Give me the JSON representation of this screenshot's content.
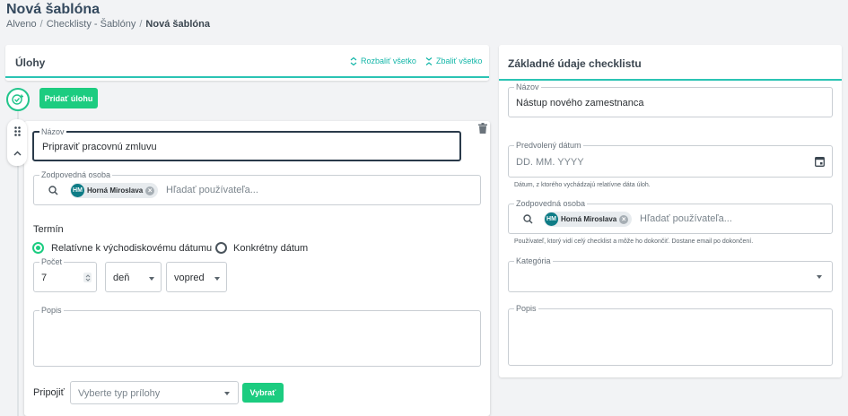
{
  "page": {
    "title": "Nová šablóna"
  },
  "breadcrumb": {
    "items": [
      "Alveno",
      "Checklisty - Šablóny",
      "Nová šablóna"
    ]
  },
  "tasks_panel": {
    "title": "Úlohy",
    "expand_all": "Rozbaliť všetko",
    "collapse_all": "Zbaliť všetko",
    "add_task": "Pridať úlohu"
  },
  "task": {
    "name_label": "Názov",
    "name_value": "Pripraviť pracovnú zmluvu",
    "responsible_label": "Zodpovedná osoba",
    "responsible_chip_initials": "HM",
    "responsible_chip_name": "Horná Miroslava",
    "responsible_placeholder": "Hľadať používateľa...",
    "deadline_label": "Termín",
    "radio_relative": "Relatívne k východiskovému dátumu",
    "radio_specific": "Konkrétny dátum",
    "count_label": "Počet",
    "count_value": "7",
    "unit_value": "deň",
    "direction_value": "vopred",
    "description_label": "Popis",
    "attach_label": "Pripojiť",
    "attach_placeholder": "Vyberte typ prílohy",
    "choose_button": "Vybrať"
  },
  "basic_panel": {
    "title": "Základné údaje checklistu",
    "name_label": "Názov",
    "name_value": "Nástup nového zamestnanca",
    "date_label": "Predvolený dátum",
    "date_placeholder": "DD. MM. YYYY",
    "date_helper": "Dátum, z ktorého vychádzajú relatívne dáta úloh.",
    "responsible_label": "Zodpovedná osoba",
    "responsible_chip_initials": "HM",
    "responsible_chip_name": "Horná Miroslava",
    "responsible_placeholder": "Hľadať používateľa...",
    "responsible_helper": "Používateľ, ktorý vidí celý checklist a môže ho dokončiť. Dostane email po dokončení.",
    "category_label": "Kategória",
    "description_label": "Popis"
  },
  "colors": {
    "accent": "#2bc4b4",
    "primary_button": "#1ccc80",
    "avatar": "#0e7c86"
  },
  "icons": [
    "sort-expand-icon",
    "sort-collapse-icon",
    "add-task-check-icon",
    "drag-handle-icon",
    "chevron-up-icon",
    "trash-icon",
    "search-icon",
    "clear-icon",
    "calendar-icon",
    "dropdown-caret-icon"
  ]
}
